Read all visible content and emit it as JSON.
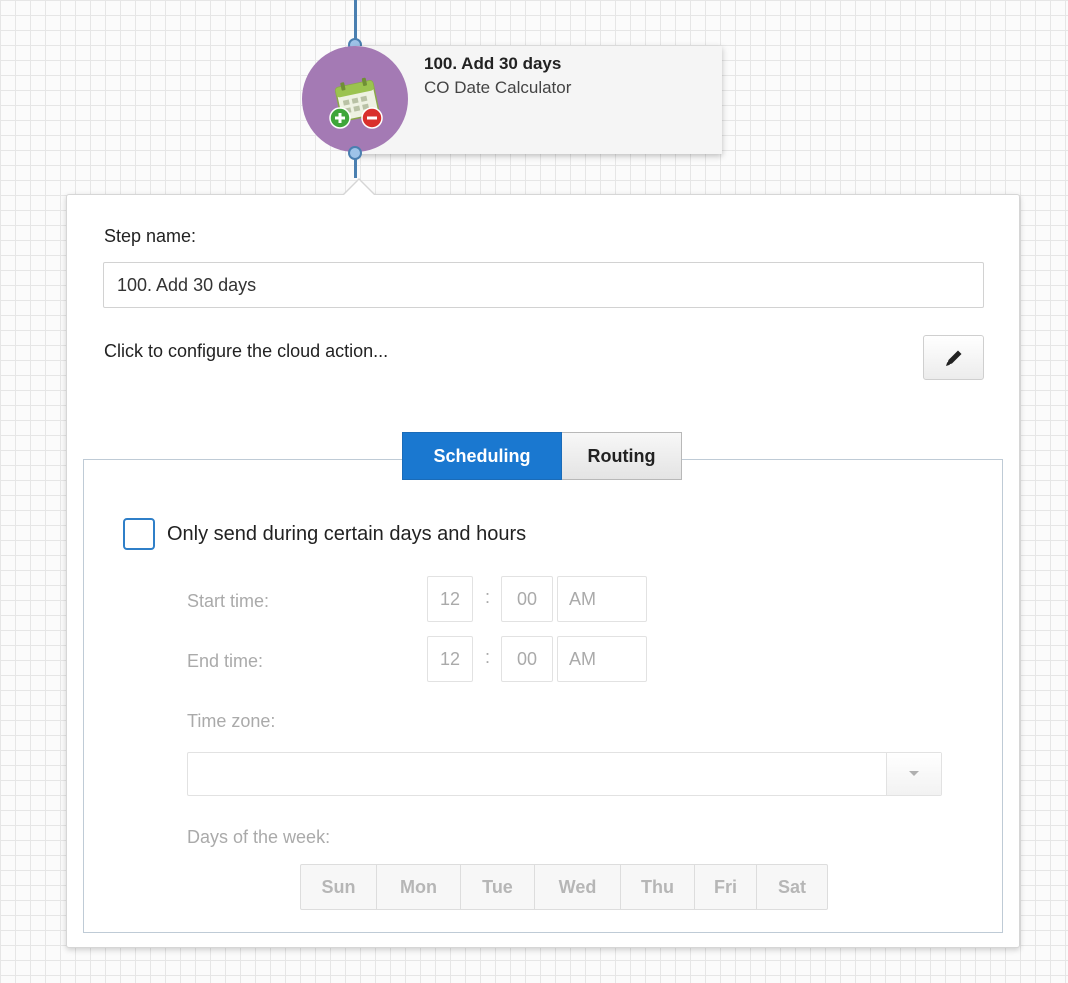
{
  "node": {
    "title": "100. Add 30 days",
    "subtitle": "CO Date Calculator",
    "icon": "calendar-add-remove-icon",
    "circle_color": "#a47ab4"
  },
  "panel": {
    "step_name_label": "Step name:",
    "step_name_value": "100. Add 30 days",
    "configure_text": "Click to configure the cloud action...",
    "edit_icon": "pencil-icon"
  },
  "tabs": [
    {
      "label": "Scheduling",
      "active": true
    },
    {
      "label": "Routing",
      "active": false
    }
  ],
  "scheduling": {
    "checkbox_label": "Only send during certain days and hours",
    "checkbox_checked": false,
    "start_time_label": "Start time:",
    "start_time": {
      "hour": "12",
      "separator": ":",
      "minute": "00",
      "ampm": "AM"
    },
    "end_time_label": "End time:",
    "end_time": {
      "hour": "12",
      "separator": ":",
      "minute": "00",
      "ampm": "AM"
    },
    "time_zone_label": "Time zone:",
    "time_zone_value": "",
    "days_label": "Days of the week:",
    "days": [
      "Sun",
      "Mon",
      "Tue",
      "Wed",
      "Thu",
      "Fri",
      "Sat"
    ]
  },
  "colors": {
    "accent": "#1a78d0",
    "connector": "#4a7fb0",
    "disabled_text": "#aaaaaa"
  }
}
